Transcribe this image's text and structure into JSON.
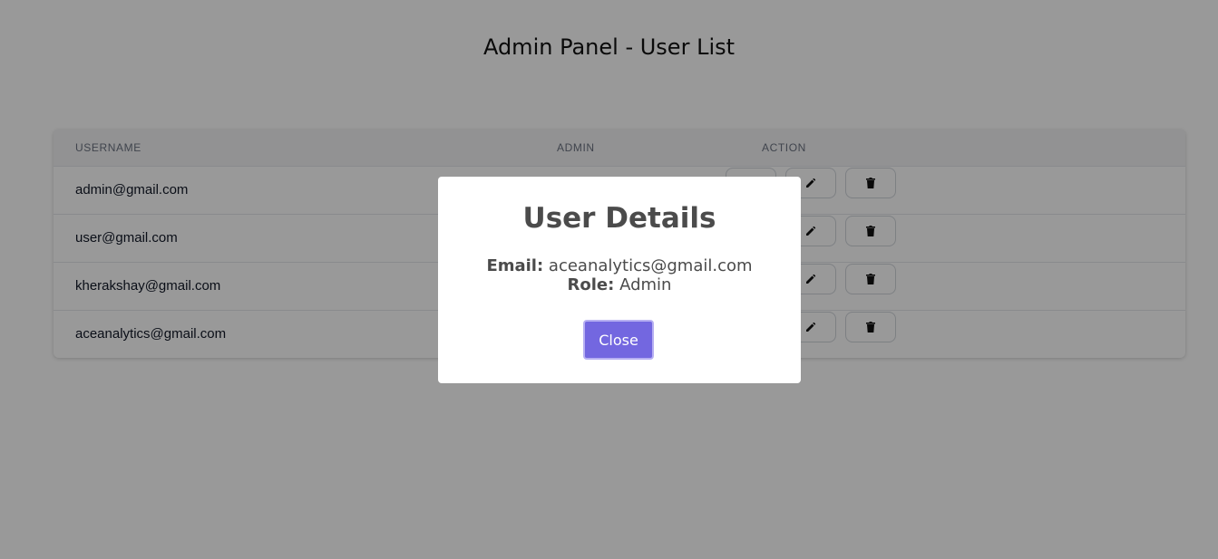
{
  "page": {
    "title": "Admin Panel - User List"
  },
  "table": {
    "headers": {
      "username": "USERNAME",
      "admin": "ADMIN",
      "action": "ACTION"
    },
    "rows": [
      {
        "username": "admin@gmail.com"
      },
      {
        "username": "user@gmail.com"
      },
      {
        "username": "kherakshay@gmail.com"
      },
      {
        "username": "aceanalytics@gmail.com"
      }
    ],
    "actions": {
      "edit_icon": "pencil-icon",
      "delete_icon": "trash-icon"
    }
  },
  "modal": {
    "title": "User Details",
    "email_label": "Email:",
    "email_value": "aceanalytics@gmail.com",
    "role_label": "Role:",
    "role_value": "Admin",
    "close_label": "Close"
  },
  "colors": {
    "overlay": "#000000",
    "close_button_bg": "#7367e0",
    "close_button_border": "#b7b0f2",
    "header_bg": "#f3f4f6"
  }
}
